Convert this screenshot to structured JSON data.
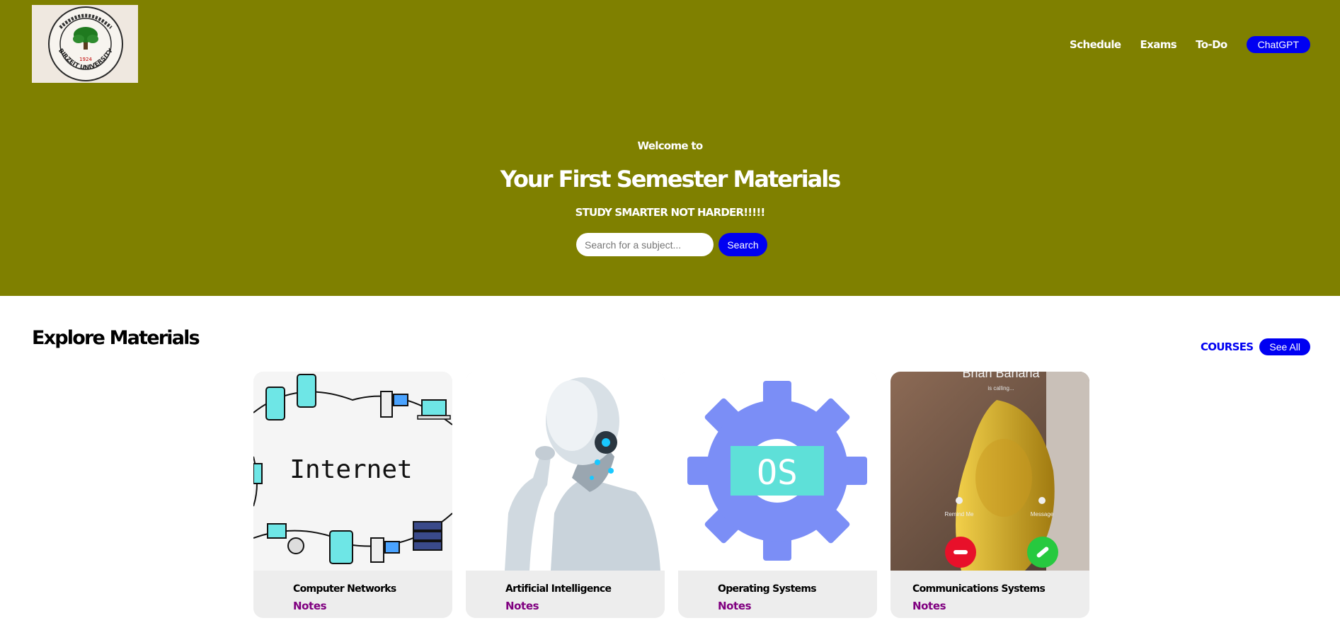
{
  "colors": {
    "hero_bg": "#7f8000",
    "accent": "#0000f2",
    "notes": "#800080",
    "card_bg": "#ededed"
  },
  "logo": {
    "year": "1924",
    "text": "BIRZEIT UNIVERSITY",
    "icon": "university-seal-icon"
  },
  "nav": {
    "links": [
      "Schedule",
      "Exams",
      "To-Do"
    ],
    "button": "ChatGPT"
  },
  "hero": {
    "welcome": "Welcome to",
    "title": "Your First Semester Materials",
    "subtitle": "STUDY SMARTER NOT HARDER!!!!!",
    "search_placeholder": "Search for a subject...",
    "search_button": "Search"
  },
  "explore": {
    "title": "Explore Materials",
    "courses_label": "COURSES",
    "see_all": "See All"
  },
  "cards": [
    {
      "title": "Computer Networks",
      "link": "Notes",
      "image": "internet-network-icon",
      "image_text": "Internet"
    },
    {
      "title": "Artificial Intelligence",
      "link": "Notes",
      "image": "thinking-robot-icon"
    },
    {
      "title": "Operating Systems",
      "link": "Notes",
      "image": "os-gear-icon",
      "image_text": "OS"
    },
    {
      "title": "Communications Systems",
      "link": "Notes",
      "image": "banana-phone-call-icon",
      "image_text": "Brian Banana",
      "image_caption": "is calling...",
      "remind": "Remind Me",
      "message": "Message"
    }
  ]
}
